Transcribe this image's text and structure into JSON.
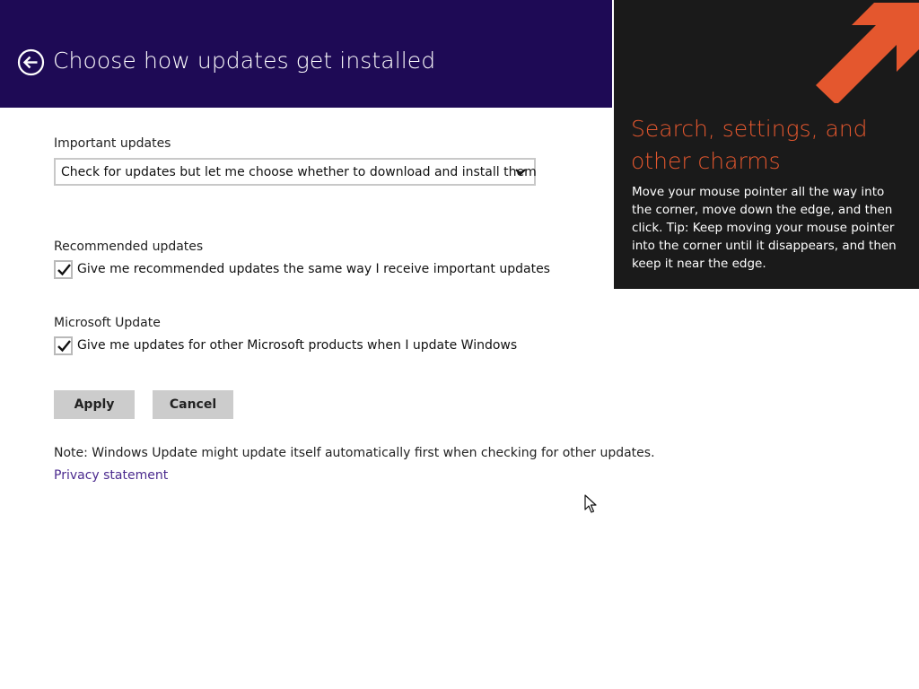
{
  "header": {
    "title": "Choose how updates get installed",
    "back_icon": "back-arrow-circle-icon",
    "background": "#1e0a55"
  },
  "important_updates": {
    "label": "Important updates",
    "selected": "Check for updates but let me choose whether to download and install them"
  },
  "recommended_updates": {
    "label": "Recommended updates",
    "checkbox_label": "Give me recommended updates the same way I receive important updates",
    "checked": true
  },
  "microsoft_update": {
    "label": "Microsoft Update",
    "checkbox_label": "Give me updates for other Microsoft products when I update Windows",
    "checked": true
  },
  "buttons": {
    "apply": "Apply",
    "cancel": "Cancel"
  },
  "note": "Note: Windows Update might update itself automatically first when checking for other updates.",
  "privacy_link": "Privacy statement",
  "charms_tip": {
    "title": "Search, settings, and other charms",
    "body": "Move your mouse pointer all the way into the corner, move down the edge, and then click. Tip: Keep moving your mouse pointer into the corner until it disappears, and then keep it near the edge.",
    "accent": "#e4572e",
    "arrow_icon": "diagonal-arrow-up-right-icon"
  }
}
